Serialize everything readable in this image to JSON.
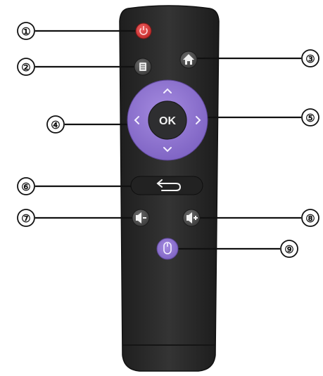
{
  "diagram": {
    "buttons": [
      {
        "id": "power",
        "icon": "power-icon"
      },
      {
        "id": "menu",
        "icon": "menu-icon"
      },
      {
        "id": "home",
        "icon": "home-icon"
      },
      {
        "id": "ok",
        "label": "OK",
        "icon": "ok-button"
      },
      {
        "id": "dpad",
        "icon": "direction-arrows"
      },
      {
        "id": "back",
        "icon": "return-arrow-icon"
      },
      {
        "id": "volume_down",
        "icon": "speaker-minus-icon"
      },
      {
        "id": "volume_up",
        "icon": "speaker-plus-icon"
      },
      {
        "id": "mouse",
        "icon": "mouse-icon"
      }
    ],
    "callouts": [
      "①",
      "②",
      "③",
      "④",
      "⑤",
      "⑥",
      "⑦",
      "⑧",
      "⑨"
    ],
    "colors": {
      "remote_body": "#2b2b2b",
      "power_button": "#d93a3a",
      "dpad_ring": "#8a6fcc",
      "ok_center": "#2e2e30",
      "round_button": "#5a5a5a",
      "mouse_button": "#8a6fcc",
      "leader_line": "#111111"
    }
  }
}
